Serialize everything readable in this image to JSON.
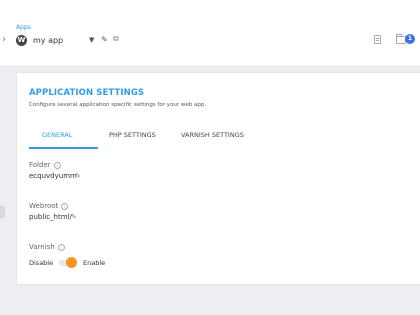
{
  "header": {
    "apps_label": "Apps",
    "app_name": "my app",
    "wp_glyph": "W",
    "caret": "▼",
    "pen_glyph": "✎",
    "ext_glyph": "⧉",
    "chevron": "›",
    "notification_count": "1"
  },
  "card": {
    "title": "APPLICATION SETTINGS",
    "subtitle": "Configure several application specific settings for your web app.",
    "tabs": [
      {
        "label": "GENERAL"
      },
      {
        "label": "PHP SETTINGS"
      },
      {
        "label": "VARNISH SETTINGS"
      }
    ],
    "folder": {
      "label": "Folder",
      "value": "ecquvdyumm"
    },
    "webroot": {
      "label": "Webroot",
      "value": "public_html/"
    },
    "varnish": {
      "label": "Varnish",
      "off_label": "Disable",
      "on_label": "Enable",
      "enabled": true
    },
    "edit_glyph": "✎",
    "info_glyph": "i"
  },
  "colors": {
    "accent": "#2f9de4",
    "toggle": "#f7931e",
    "badge": "#3d6fe0"
  }
}
